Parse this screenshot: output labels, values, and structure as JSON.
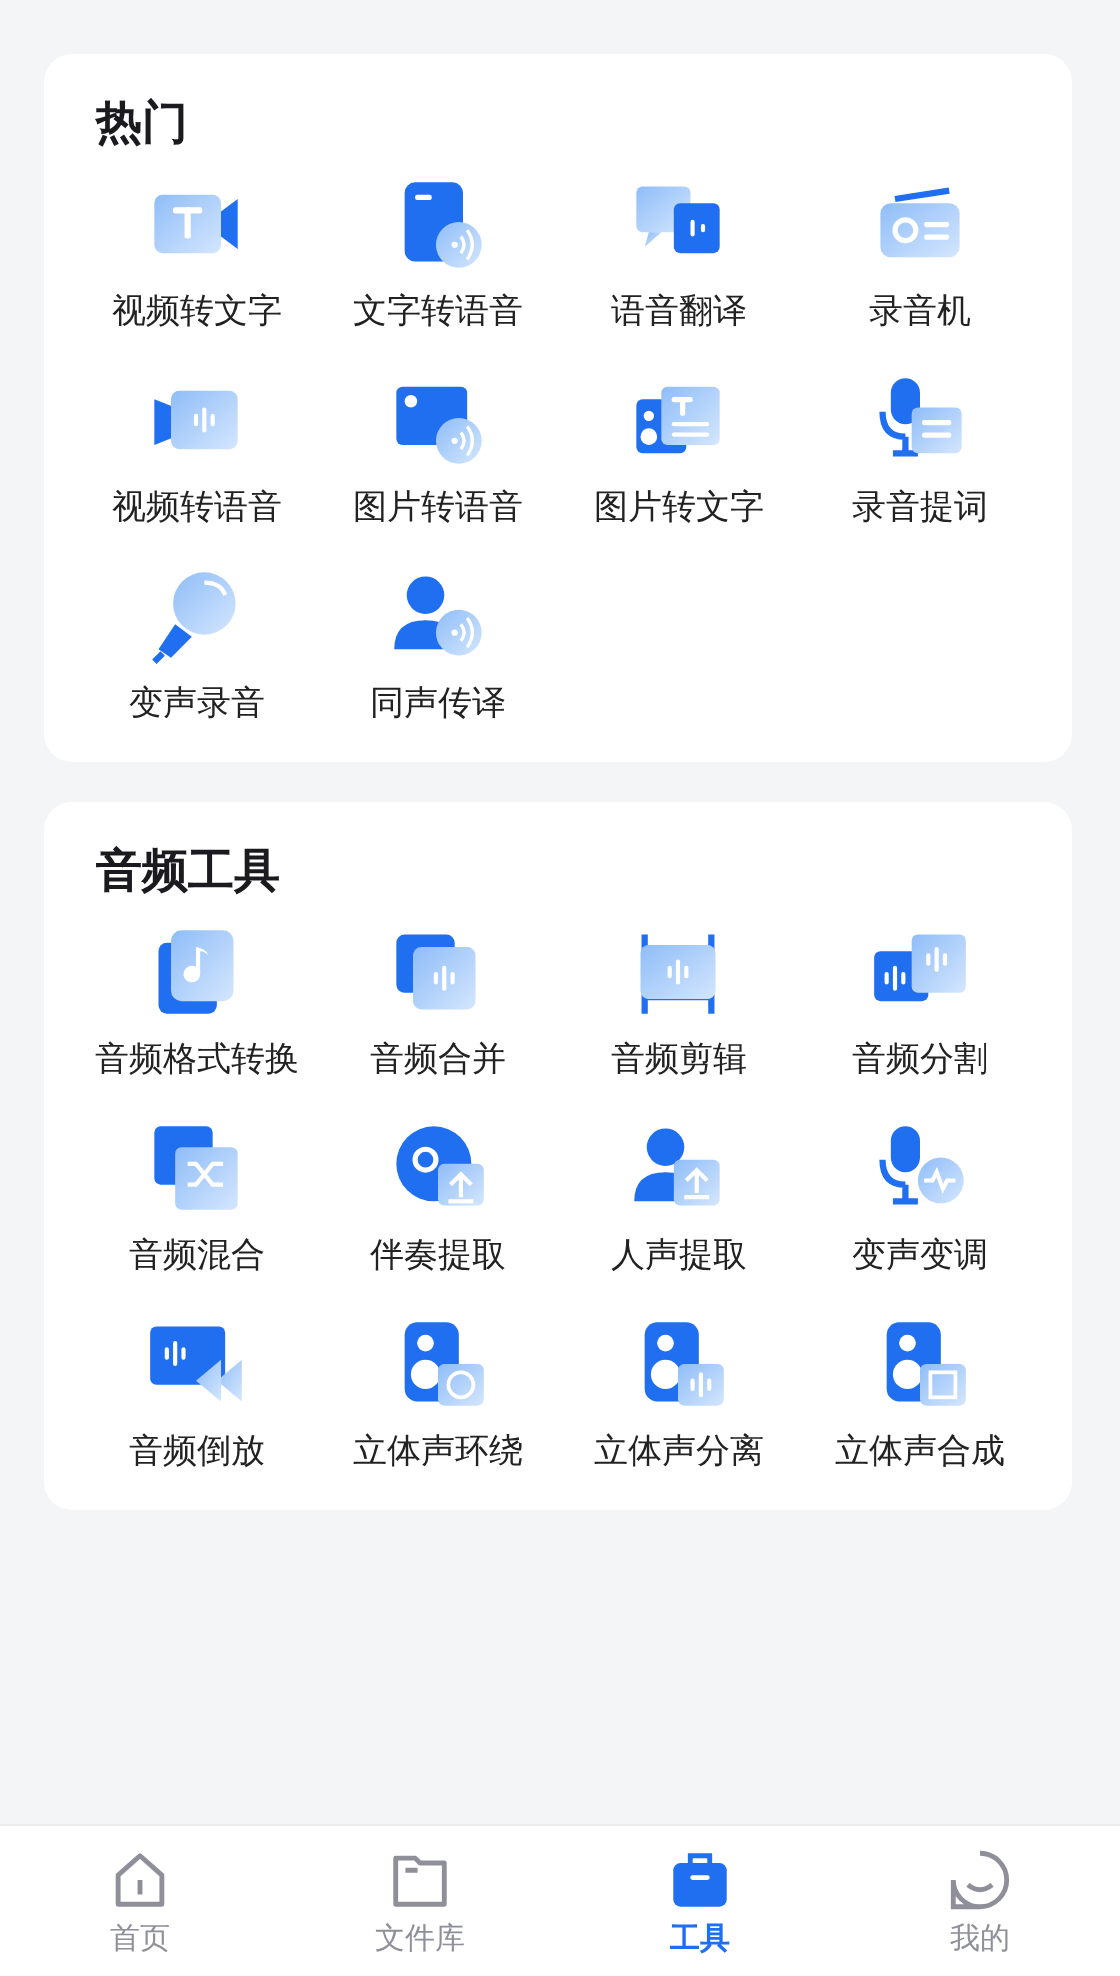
{
  "sections": [
    {
      "title": "热门",
      "tools": [
        {
          "label": "视频转文字"
        },
        {
          "label": "文字转语音"
        },
        {
          "label": "语音翻译"
        },
        {
          "label": "录音机"
        },
        {
          "label": "视频转语音"
        },
        {
          "label": "图片转语音"
        },
        {
          "label": "图片转文字"
        },
        {
          "label": "录音提词"
        },
        {
          "label": "变声录音"
        },
        {
          "label": "同声传译"
        }
      ]
    },
    {
      "title": "音频工具",
      "tools": [
        {
          "label": "音频格式转换"
        },
        {
          "label": "音频合并"
        },
        {
          "label": "音频剪辑"
        },
        {
          "label": "音频分割"
        },
        {
          "label": "音频混合"
        },
        {
          "label": "伴奏提取"
        },
        {
          "label": "人声提取"
        },
        {
          "label": "变声变调"
        },
        {
          "label": "音频倒放"
        },
        {
          "label": "立体声环绕"
        },
        {
          "label": "立体声分离"
        },
        {
          "label": "立体声合成"
        }
      ]
    }
  ],
  "bottom_nav": [
    {
      "label": "首页",
      "selected": false
    },
    {
      "label": "文件库",
      "selected": false
    },
    {
      "label": "工具",
      "selected": true
    },
    {
      "label": "我的",
      "selected": false
    }
  ]
}
